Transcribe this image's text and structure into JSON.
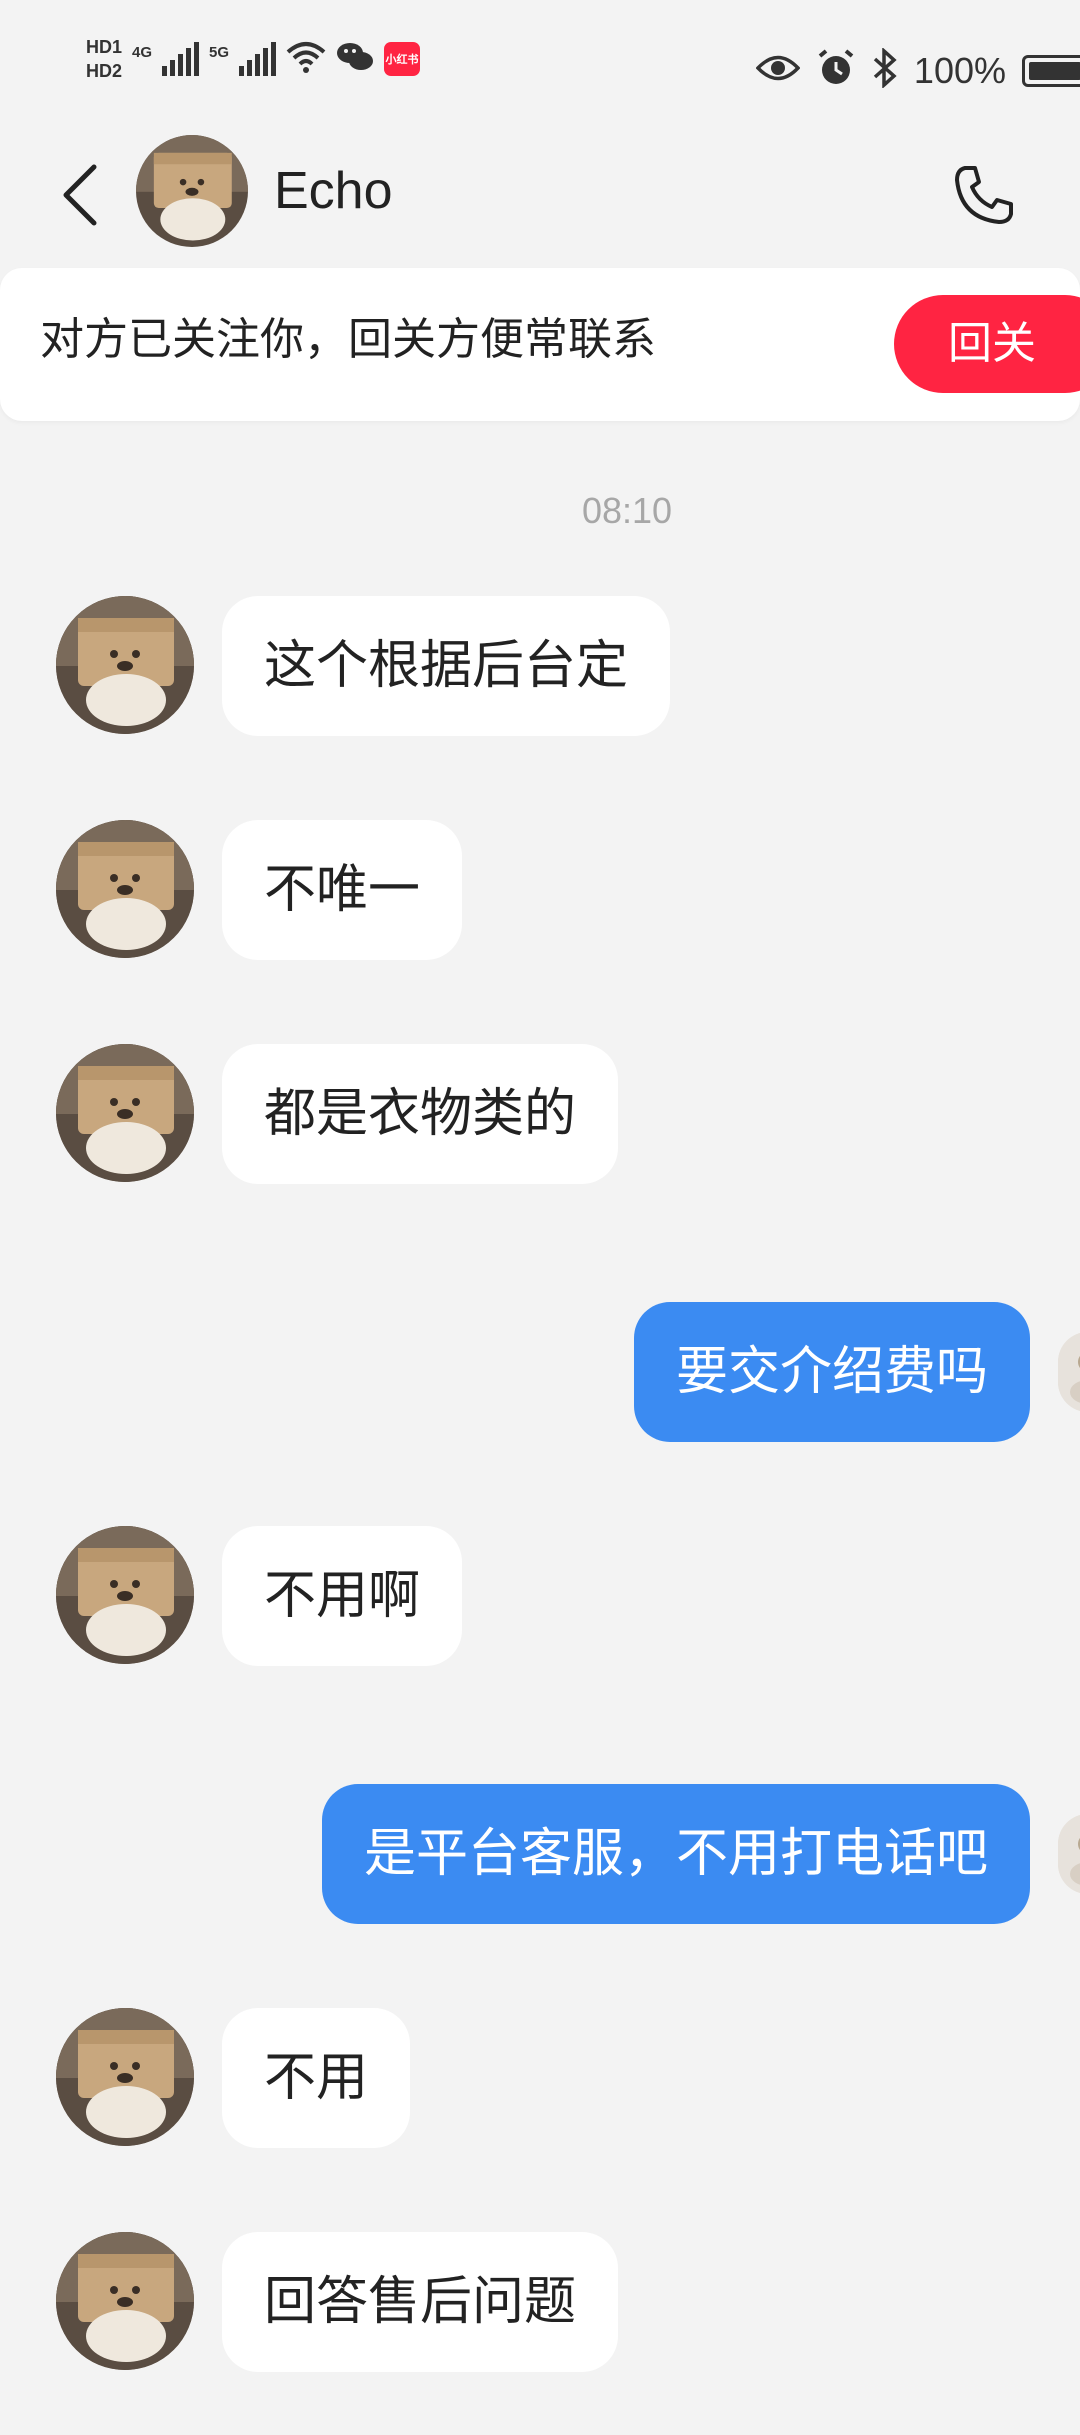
{
  "status_bar": {
    "hd1": "HD1",
    "hd2": "HD2",
    "net1": "4G",
    "net2": "5G",
    "xhs_badge": "小红书",
    "battery": "100%",
    "icons": [
      "signal-icon",
      "wifi-icon",
      "wechat-icon",
      "eye-icon",
      "alarm-icon",
      "bluetooth-icon",
      "battery-icon"
    ]
  },
  "header": {
    "contact_name": "Echo",
    "back_icon": "chevron-left-icon",
    "call_icon": "phone-icon"
  },
  "follow_banner": {
    "text": "对方已关注你，回关方便常联系",
    "button_label": "回关",
    "accent_color": "#ff2442"
  },
  "timestamp": "08:10",
  "messages": [
    {
      "side": "in",
      "text": "这个根据后台定"
    },
    {
      "side": "in",
      "text": "不唯一"
    },
    {
      "side": "in",
      "text": "都是衣物类的"
    },
    {
      "side": "out",
      "text": "要交介绍费吗"
    },
    {
      "side": "in",
      "text": "不用啊"
    },
    {
      "side": "out",
      "text": "是平台客服，不用打电话吧"
    },
    {
      "side": "in",
      "text": "不用"
    },
    {
      "side": "in",
      "text": "回答售后问题"
    }
  ],
  "colors": {
    "background": "#f3f3f3",
    "incoming_bubble": "#ffffff",
    "outgoing_bubble": "#3b8bf2",
    "follow_button": "#ff2442",
    "timestamp_text": "#a7a7a7"
  }
}
